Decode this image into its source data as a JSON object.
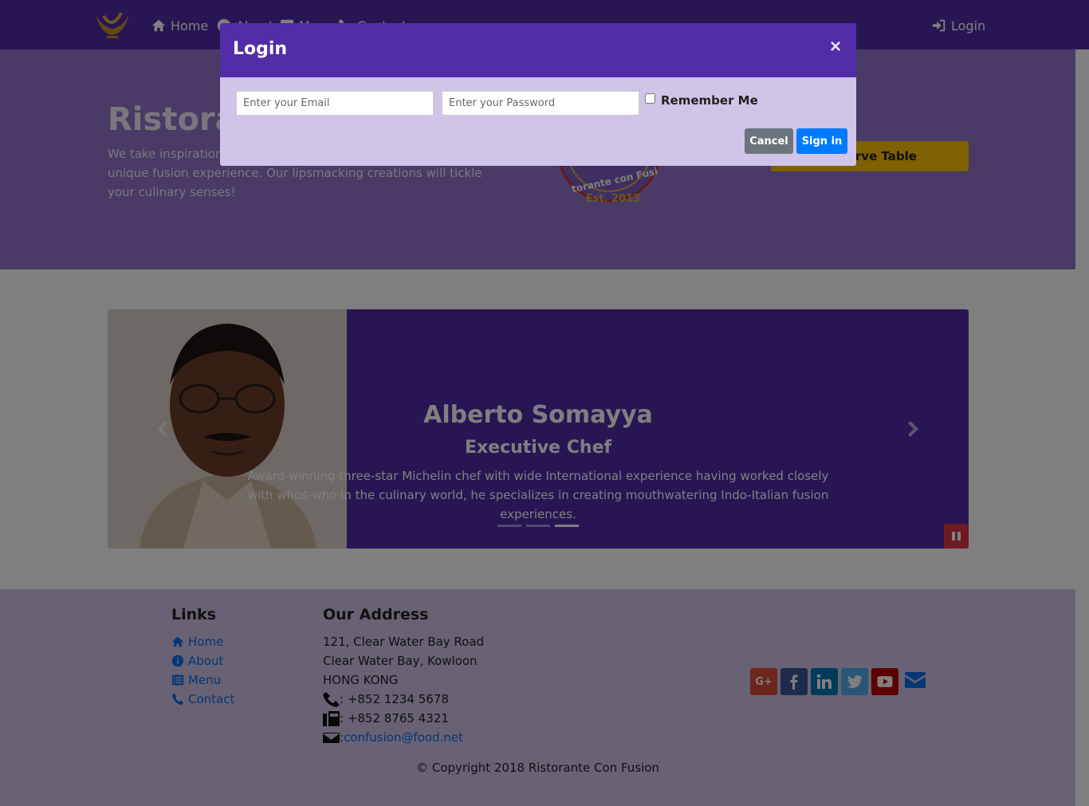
{
  "navbar": {
    "items": [
      {
        "label": "Home",
        "icon": "home-icon"
      },
      {
        "label": "About",
        "icon": "info-icon"
      },
      {
        "label": "Menu",
        "icon": "list-icon"
      },
      {
        "label": "Contact",
        "icon": "phone-icon"
      }
    ],
    "login_label": "Login",
    "color": "#512DA8"
  },
  "jumbotron": {
    "title": "Ristorante con Fusion",
    "text": "We take inspiration from the World's best cuisines, and create a unique fusion experience. Our lipsmacking creations will tickle your culinary senses!",
    "logo_text": "Ristorante con Fusion",
    "logo_year": "Est. 2013",
    "reserve_label": "Reserve Table",
    "color": "#9575CD"
  },
  "carousel": {
    "name": "Alberto Somayya",
    "role": "Executive Chef",
    "description": "Award winning three-star Michelin chef with wide International experience having worked closely with whos-who in the culinary world, he specializes in creating mouthwatering Indo-Italian fusion experiences.",
    "active_index": 2,
    "slide_count": 3
  },
  "footer": {
    "links_heading": "Links",
    "links": [
      {
        "label": "Home",
        "icon": "home-icon"
      },
      {
        "label": "About",
        "icon": "info-icon"
      },
      {
        "label": "Menu",
        "icon": "list-icon"
      },
      {
        "label": "Contact",
        "icon": "phone-icon"
      }
    ],
    "address_heading": "Our Address",
    "address_lines": [
      "121, Clear Water Bay Road",
      "Clear Water Bay, Kowloon",
      "HONG KONG"
    ],
    "phone": ": +852 1234 5678",
    "fax": ": +852 8765 4321",
    "email_prefix": ": ",
    "email": "confusion@food.net",
    "socials": [
      "google-plus",
      "facebook",
      "linkedin",
      "twitter",
      "youtube",
      "mail"
    ],
    "copyright": "© Copyright 2018 Ristorante Con Fusion"
  },
  "modal": {
    "title": "Login",
    "close_label": "×",
    "email_placeholder": "Enter your Email",
    "password_placeholder": "Enter your Password",
    "remember_label": "Remember Me",
    "cancel_label": "Cancel",
    "signin_label": "Sign in"
  }
}
